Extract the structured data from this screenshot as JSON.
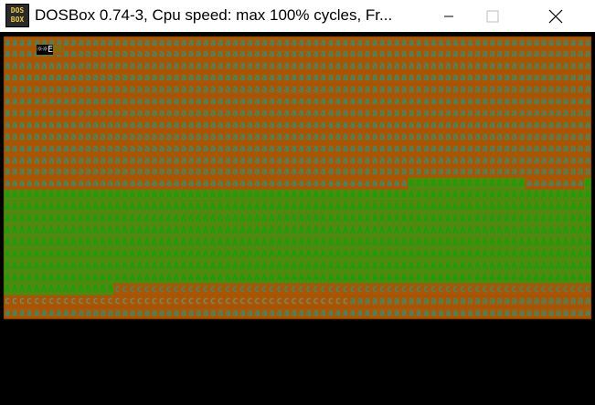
{
  "window": {
    "title": "DOSBox 0.74-3, Cpu speed: max 100% cycles, Fr...",
    "icon_text": [
      "DOS",
      "BOX"
    ],
    "controls": [
      "minimize",
      "maximize",
      "close"
    ]
  },
  "screen": {
    "status_line": [
      {
        "text": "☼☼E",
        "fg": "#ffffff",
        "bg": "#000000"
      },
      {
        "text": "BB",
        "fg": "#4a8a2a",
        "bg": "#aa5500"
      }
    ],
    "grid": {
      "columns": 80,
      "rows": 24
    },
    "colors": {
      "background": "#aa5500",
      "a_fg": "#00aaaa",
      "green_bg": "#4e8a12",
      "green_fg": "#00aa00",
      "c_bg": "#aa5500",
      "c_fg": "#00aaaa",
      "c2_fg": "#55aaaa"
    },
    "text_runs": [
      {
        "row": 0,
        "start": 0,
        "end": 80,
        "char": "a",
        "style": "a"
      },
      {
        "row": 1,
        "start": 0,
        "end": 80,
        "char": "a",
        "style": "a"
      },
      {
        "row": 2,
        "start": 0,
        "end": 80,
        "char": "a",
        "style": "a"
      },
      {
        "row": 3,
        "start": 0,
        "end": 80,
        "char": "a",
        "style": "a"
      },
      {
        "row": 4,
        "start": 0,
        "end": 80,
        "char": "a",
        "style": "a"
      },
      {
        "row": 5,
        "start": 0,
        "end": 80,
        "char": "a",
        "style": "a"
      },
      {
        "row": 6,
        "start": 0,
        "end": 80,
        "char": "a",
        "style": "a"
      },
      {
        "row": 7,
        "start": 0,
        "end": 80,
        "char": "a",
        "style": "a"
      },
      {
        "row": 8,
        "start": 0,
        "end": 80,
        "char": "a",
        "style": "a"
      },
      {
        "row": 9,
        "start": 0,
        "end": 80,
        "char": "a",
        "style": "a"
      },
      {
        "row": 10,
        "start": 0,
        "end": 80,
        "char": "a",
        "style": "a"
      },
      {
        "row": 11,
        "start": 0,
        "end": 80,
        "char": "a",
        "style": "a"
      },
      {
        "row": 12,
        "start": 0,
        "end": 55,
        "char": "a",
        "style": "a"
      },
      {
        "row": 12,
        "start": 55,
        "end": 71,
        "char": "A",
        "style": "green"
      },
      {
        "row": 12,
        "start": 71,
        "end": 79,
        "char": "a",
        "style": "a"
      },
      {
        "row": 12,
        "start": 79,
        "end": 80,
        "char": "A",
        "style": "green"
      },
      {
        "row": 13,
        "start": 0,
        "end": 80,
        "char": "A",
        "style": "green"
      },
      {
        "row": 14,
        "start": 0,
        "end": 80,
        "char": "A",
        "style": "green"
      },
      {
        "row": 15,
        "start": 0,
        "end": 80,
        "char": "A",
        "style": "green"
      },
      {
        "row": 16,
        "start": 0,
        "end": 80,
        "char": "A",
        "style": "green"
      },
      {
        "row": 17,
        "start": 0,
        "end": 80,
        "char": "A",
        "style": "green"
      },
      {
        "row": 18,
        "start": 0,
        "end": 80,
        "char": "A",
        "style": "green"
      },
      {
        "row": 19,
        "start": 0,
        "end": 80,
        "char": "A",
        "style": "green"
      },
      {
        "row": 20,
        "start": 0,
        "end": 80,
        "char": "A",
        "style": "green"
      },
      {
        "row": 21,
        "start": 0,
        "end": 15,
        "char": "A",
        "style": "green"
      },
      {
        "row": 21,
        "start": 15,
        "end": 80,
        "char": "c",
        "style": "c"
      },
      {
        "row": 22,
        "start": 0,
        "end": 47,
        "char": "c",
        "style": "c2"
      },
      {
        "row": 22,
        "start": 47,
        "end": 80,
        "char": "a",
        "style": "a"
      },
      {
        "row": 23,
        "start": 0,
        "end": 80,
        "char": "a",
        "style": "a"
      }
    ]
  }
}
